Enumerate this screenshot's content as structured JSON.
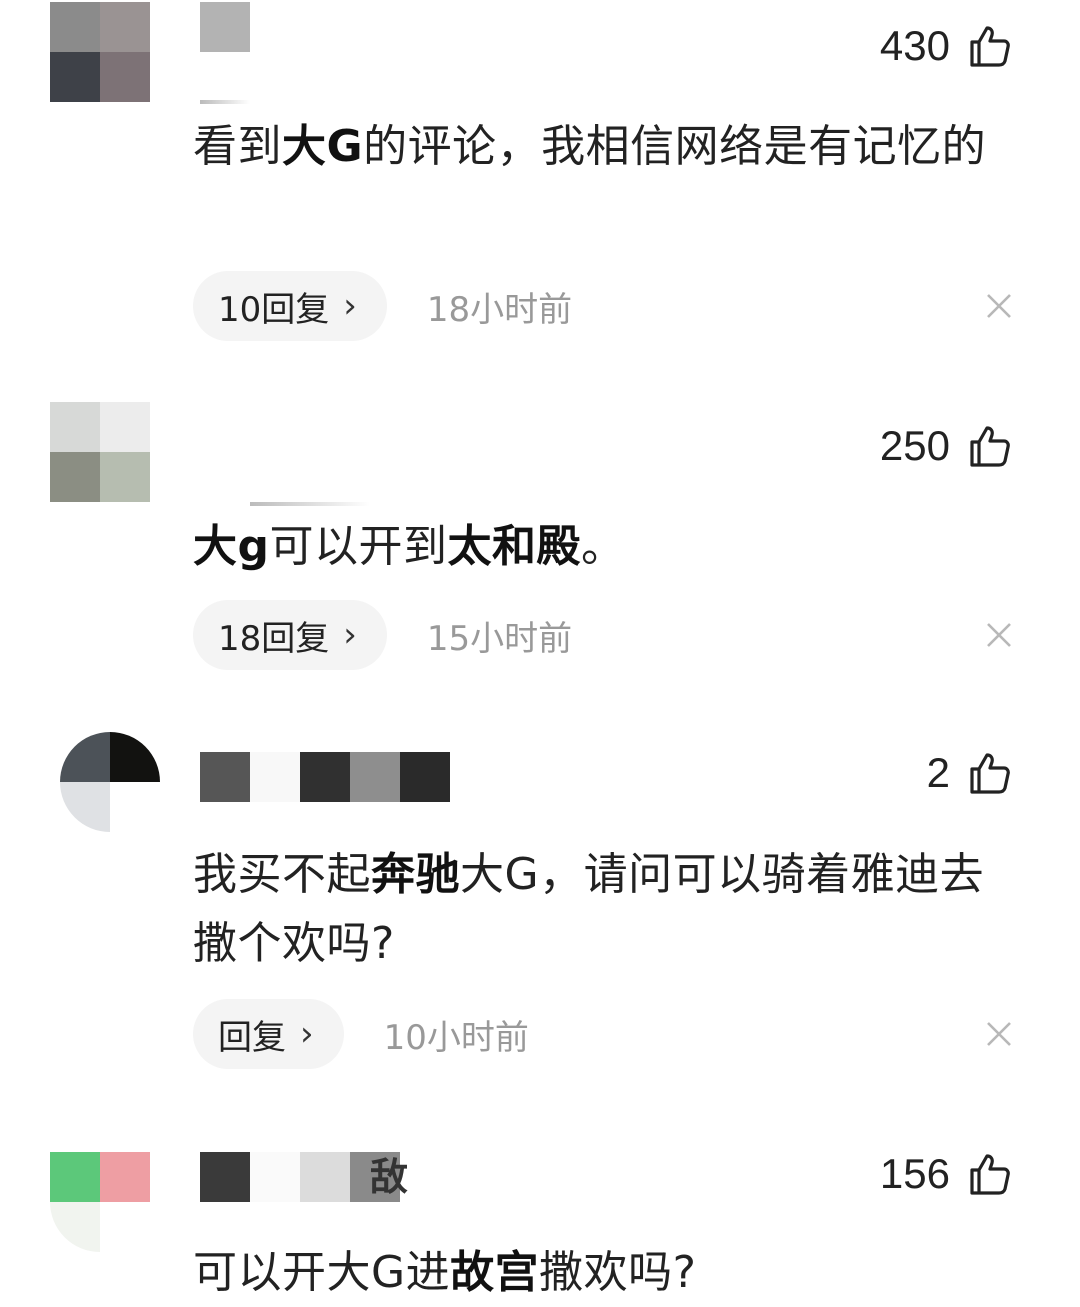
{
  "comments": [
    {
      "likes": "430",
      "text_segments": [
        {
          "t": "看到",
          "b": false
        },
        {
          "t": "大G",
          "b": true
        },
        {
          "t": "的评论，我相信网络是有记忆的",
          "b": false
        }
      ],
      "reply_label": "10回复",
      "time": "18小时前",
      "avatar_colors": [
        "#8b8b8b",
        "#9a9393",
        "#3e4148",
        "#7d7276"
      ],
      "name_colors": [
        "#b3b3b3"
      ]
    },
    {
      "likes": "250",
      "text_segments": [
        {
          "t": "大g",
          "b": true
        },
        {
          "t": "可以开到",
          "b": false
        },
        {
          "t": "太和殿",
          "b": true
        },
        {
          "t": "。",
          "b": false
        }
      ],
      "reply_label": "18回复",
      "time": "15小时前",
      "avatar_colors": [
        "#d7d9d7",
        "#ececec",
        "#8b8e83",
        "#b6bdb0"
      ],
      "name_colors": []
    },
    {
      "likes": "2",
      "text_segments": [
        {
          "t": "我买不起",
          "b": false
        },
        {
          "t": "奔驰",
          "b": true
        },
        {
          "t": "大G，请问可以骑着雅迪去撒个欢吗?",
          "b": false
        }
      ],
      "reply_label": "回复",
      "time": "10小时前",
      "avatar_colors": [
        "#4c5258",
        "#121210",
        "#dfe1e4",
        "#ffffff"
      ],
      "name_colors": [
        "#565656",
        "#f8f8f8",
        "#303030",
        "#8e8e8e",
        "#2a2a2a"
      ]
    },
    {
      "likes": "156",
      "text_segments": [
        {
          "t": "可以开大G进",
          "b": false
        },
        {
          "t": "故宫",
          "b": true
        },
        {
          "t": "撒欢吗?",
          "b": false
        }
      ],
      "name_tail": "敌",
      "avatar_colors": [
        "#5cc87a",
        "#ee9ea3",
        "#f1f4ef",
        "#ffffff"
      ],
      "name_colors": [
        "#3a3a3a",
        "#fafafa",
        "#dcdcdc",
        "#8a8a8a"
      ]
    }
  ],
  "icons": {
    "like": "thumbs-up-icon",
    "close": "close-icon",
    "chevron": "chevron-right-icon"
  },
  "chevron_glyph": "›"
}
